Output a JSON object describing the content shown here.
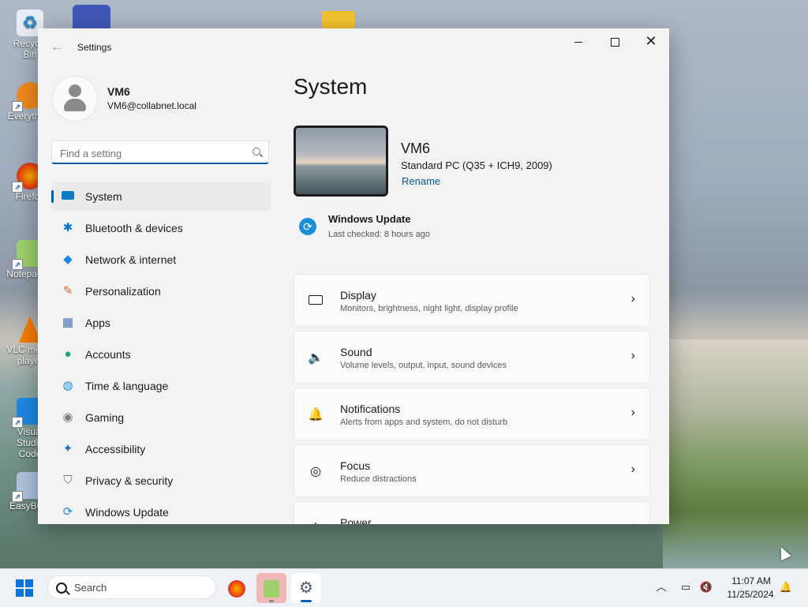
{
  "desktop": {
    "icons": [
      {
        "label": "Recycle Bin",
        "icon": "recycle-bin-icon"
      },
      {
        "label": "Everything",
        "icon": "everything-search-icon"
      },
      {
        "label": "Firefox",
        "icon": "firefox-icon"
      },
      {
        "label": "Notepad++",
        "icon": "notepad-plus-plus-icon"
      },
      {
        "label": "VLC media player",
        "icon": "vlc-icon"
      },
      {
        "label": "Visual Studio Code",
        "icon": "vscode-icon"
      },
      {
        "label": "EasyBCD",
        "icon": "easybcd-icon"
      }
    ]
  },
  "window": {
    "title": "Settings",
    "back_icon": "back-arrow-icon",
    "controls": [
      "minimize",
      "maximize",
      "close"
    ]
  },
  "profile": {
    "name": "VM6",
    "email": "VM6@collabnet.local"
  },
  "search": {
    "placeholder": "Find a setting"
  },
  "sidebar": {
    "items": [
      {
        "label": "System",
        "icon": "system-icon",
        "selected": true
      },
      {
        "label": "Bluetooth & devices",
        "icon": "bluetooth-icon"
      },
      {
        "label": "Network & internet",
        "icon": "network-icon"
      },
      {
        "label": "Personalization",
        "icon": "paintbrush-icon"
      },
      {
        "label": "Apps",
        "icon": "apps-icon"
      },
      {
        "label": "Accounts",
        "icon": "accounts-icon"
      },
      {
        "label": "Time & language",
        "icon": "globe-clock-icon"
      },
      {
        "label": "Gaming",
        "icon": "gamepad-icon"
      },
      {
        "label": "Accessibility",
        "icon": "accessibility-icon"
      },
      {
        "label": "Privacy & security",
        "icon": "shield-icon"
      },
      {
        "label": "Windows Update",
        "icon": "windows-update-icon"
      }
    ]
  },
  "main": {
    "title": "System",
    "device": {
      "name": "VM6",
      "model": "Standard PC (Q35 + ICH9, 2009)",
      "rename": "Rename"
    },
    "windows_update": {
      "title": "Windows Update",
      "subtitle": "Last checked: 8 hours ago"
    },
    "cards": [
      {
        "title": "Display",
        "subtitle": "Monitors, brightness, night light, display profile",
        "icon": "display-icon"
      },
      {
        "title": "Sound",
        "subtitle": "Volume levels, output, input, sound devices",
        "icon": "speaker-icon"
      },
      {
        "title": "Notifications",
        "subtitle": "Alerts from apps and system, do not disturb",
        "icon": "bell-icon"
      },
      {
        "title": "Focus",
        "subtitle": "Reduce distractions",
        "icon": "focus-icon"
      },
      {
        "title": "Power",
        "subtitle": "",
        "icon": "power-icon"
      }
    ]
  },
  "taskbar": {
    "search_label": "Search",
    "apps": [
      "firefox-icon",
      "notepad-plus-plus-icon",
      "settings-gear-icon"
    ],
    "clock": {
      "time": "11:07 AM",
      "date": "11/25/2024"
    }
  },
  "colors": {
    "accent": "#005fb8",
    "link": "#005a9e"
  }
}
